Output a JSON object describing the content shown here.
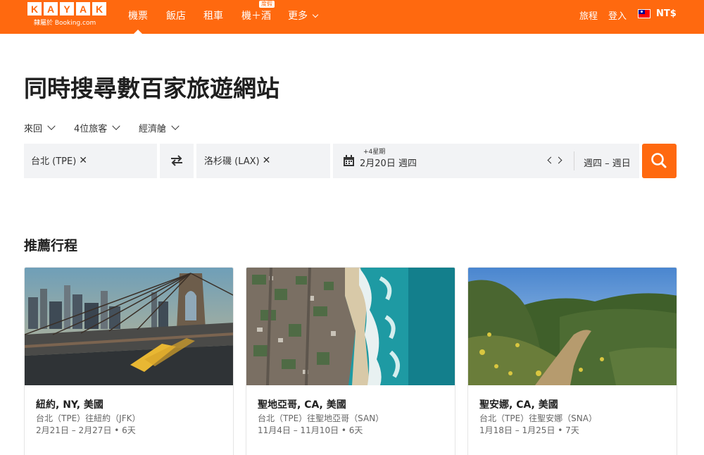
{
  "header": {
    "logo_letters": [
      "K",
      "A",
      "Y",
      "A",
      "K"
    ],
    "logo_sub": "隸屬於 Booking.com",
    "nav": [
      {
        "label": "機票",
        "active": true
      },
      {
        "label": "飯店",
        "active": false
      },
      {
        "label": "租車",
        "active": false
      },
      {
        "label": "機＋酒",
        "active": false,
        "badge": "度假"
      },
      {
        "label": "更多",
        "active": false
      }
    ],
    "trips_label": "旅程",
    "login_label": "登入",
    "currency_label": "NT$"
  },
  "hero": {
    "title": "同時搜尋數百家旅遊網站"
  },
  "options": {
    "trip_type": "來回",
    "travelers": "4位旅客",
    "cabin": "經濟艙"
  },
  "search": {
    "origin": "台北 (TPE)",
    "destination": "洛杉磯 (LAX)",
    "date_offset": "+4星期",
    "date_main": "2月20日 週四",
    "day_range": "週四 – 週日"
  },
  "recommended": {
    "title": "推薦行程",
    "cards": [
      {
        "city": "紐約, NY, 美國",
        "route": "台北（TPE）往紐約（JFK）",
        "dates": "2月21日 – 2月27日 • 6天"
      },
      {
        "city": "聖地亞哥, CA, 美國",
        "route": "台北（TPE）往聖地亞哥（SAN）",
        "dates": "11月4日 – 11月10日 • 6天"
      },
      {
        "city": "聖安娜, CA, 美國",
        "route": "台北（TPE）往聖安娜（SNA）",
        "dates": "1月18日 – 1月25日 • 7天"
      }
    ]
  },
  "colors": {
    "brand": "#ff690f",
    "field_bg": "#f2f3f5"
  }
}
